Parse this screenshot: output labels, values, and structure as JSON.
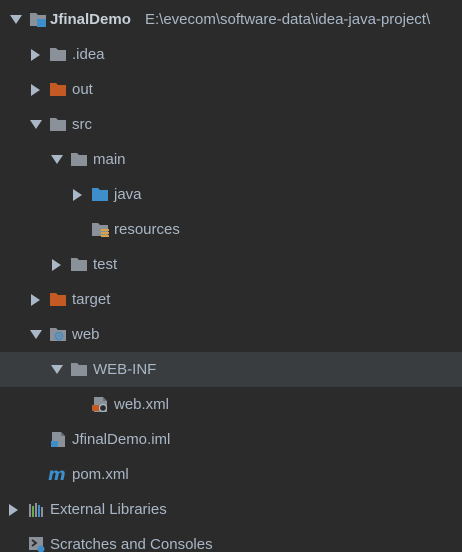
{
  "project": {
    "name": "JfinalDemo",
    "path": "E:\\evecom\\software-data\\idea-java-project\\"
  },
  "nodes": {
    "idea": ".idea",
    "out": "out",
    "src": "src",
    "main": "main",
    "java": "java",
    "resources": "resources",
    "test": "test",
    "target": "target",
    "web": "web",
    "webinf": "WEB-INF",
    "webxml": "web.xml",
    "iml": "JfinalDemo.iml",
    "pom": "pom.xml",
    "external_libraries": "External Libraries",
    "scratches": "Scratches and Consoles"
  },
  "colors": {
    "background": "#2b2b2b",
    "selected_row": "#3a3d3f",
    "folder_gray": "#8a9199",
    "folder_orange": "#c45a23",
    "folder_blue": "#3d8ecb",
    "text": "#a9b7c6"
  },
  "icons": {
    "project": "project-folder-icon",
    "folder": "folder-icon",
    "excluded_folder": "excluded-folder-icon",
    "source_folder": "source-folder-icon",
    "resources_folder": "resources-folder-icon",
    "web_folder": "web-folder-icon",
    "xml_file": "web-xml-file-icon",
    "iml_file": "iml-file-icon",
    "maven_file": "maven-pom-icon",
    "libraries": "libraries-icon",
    "scratches": "scratches-icon"
  }
}
